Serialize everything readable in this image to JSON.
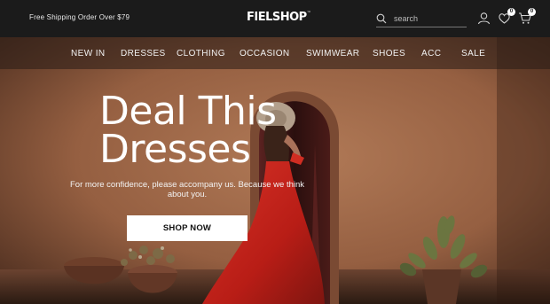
{
  "topbar": {
    "promo_text": "Free Shipping Order Over $79",
    "logo_text": "FIELSHOP",
    "logo_mark": "™",
    "search_placeholder": "search",
    "wishlist_count": "0",
    "cart_count": "0"
  },
  "nav": {
    "items": [
      {
        "label": "NEW IN"
      },
      {
        "label": "DRESSES"
      },
      {
        "label": "CLOTHING"
      },
      {
        "label": "OCCASION"
      },
      {
        "label": "SWIMWEAR"
      },
      {
        "label": "SHOES"
      },
      {
        "label": "ACC"
      },
      {
        "label": "SALE"
      }
    ]
  },
  "hero": {
    "headline_line1": "Deal This",
    "headline_line2": "Dresses",
    "subtext": "For more confidence, please accompany us. Because we think about you.",
    "cta_label": "SHOP NOW"
  },
  "colors": {
    "topbar_bg": "#1b1b1b",
    "wall": "#a0694a",
    "dress_red": "#c4231c",
    "button_bg": "#ffffff"
  }
}
